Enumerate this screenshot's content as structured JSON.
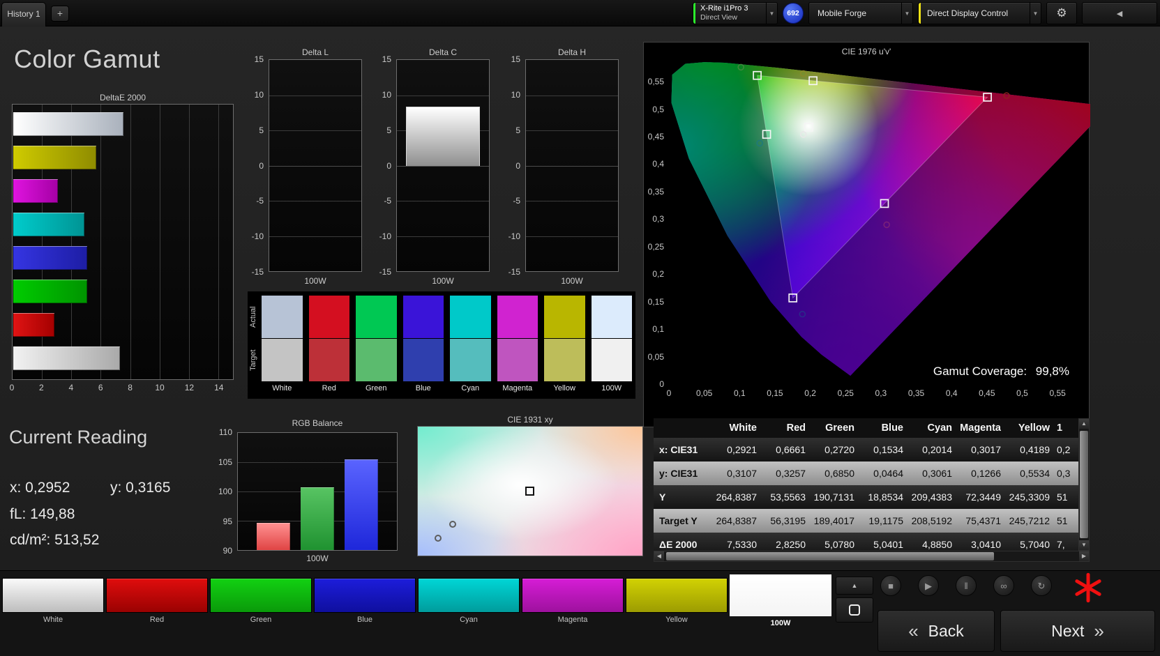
{
  "page_title": "Color Gamut",
  "top_bar": {
    "history_tab": "History 1",
    "add_tab_label": "+",
    "meter_line1": "X-Rite i1Pro 3",
    "meter_line2": "Direct View",
    "badge_count": "692",
    "pattern_source": "Mobile Forge",
    "display_control": "Direct Display Control"
  },
  "icons": {
    "dropdown": "▼",
    "gear": "⚙",
    "collapse_left": "◀",
    "up_chevron": "▲",
    "stop": "■",
    "play": "▶",
    "pause": "‖",
    "loop": "∞",
    "refresh": "↻",
    "scroll_up": "▲",
    "scroll_down": "▼",
    "scroll_left": "◀",
    "scroll_right": "▶",
    "back_chevron": "«",
    "next_chevron": "»"
  },
  "current_reading": {
    "title": "Current Reading",
    "x": "x: 0,2952",
    "y": "y: 0,3165",
    "fl": "fL: 149,88",
    "luminance": "cd/m²: 513,52"
  },
  "swatch_panel": {
    "row_labels": [
      "Actual",
      "Target"
    ],
    "columns": [
      {
        "name": "White",
        "actual": "#b7c3d6",
        "target": "#c4c4c4"
      },
      {
        "name": "Red",
        "actual": "#d40f20",
        "target": "#bd3038"
      },
      {
        "name": "Green",
        "actual": "#00c853",
        "target": "#5bbb6e"
      },
      {
        "name": "Blue",
        "actual": "#3a14d8",
        "target": "#2f3fae"
      },
      {
        "name": "Cyan",
        "actual": "#00c9c9",
        "target": "#55bdbd"
      },
      {
        "name": "Magenta",
        "actual": "#d023d0",
        "target": "#bf55bf"
      },
      {
        "name": "Yellow",
        "actual": "#b9b600",
        "target": "#bdbd5a"
      },
      {
        "name": "100W",
        "actual": "#dcebfc",
        "target": "#f0f0f0"
      }
    ]
  },
  "table": {
    "headers": [
      "White",
      "Red",
      "Green",
      "Blue",
      "Cyan",
      "Magenta",
      "Yellow",
      "1"
    ],
    "rows": [
      {
        "label": "x: CIE31",
        "values": [
          "0,2921",
          "0,6661",
          "0,2720",
          "0,1534",
          "0,2014",
          "0,3017",
          "0,4189",
          "0,2"
        ]
      },
      {
        "label": "y: CIE31",
        "values": [
          "0,3107",
          "0,3257",
          "0,6850",
          "0,0464",
          "0,3061",
          "0,1266",
          "0,5534",
          "0,3"
        ]
      },
      {
        "label": "Y",
        "values": [
          "264,8387",
          "53,5563",
          "190,7131",
          "18,8534",
          "209,4383",
          "72,3449",
          "245,3309",
          "51"
        ]
      },
      {
        "label": "Target Y",
        "values": [
          "264,8387",
          "56,3195",
          "189,4017",
          "19,1175",
          "208,5192",
          "75,4371",
          "245,7212",
          "51"
        ]
      },
      {
        "label": "ΔE 2000",
        "values": [
          "7,5330",
          "2,8250",
          "5,0780",
          "5,0401",
          "4,8850",
          "3,0410",
          "5,7040",
          "7,"
        ]
      }
    ]
  },
  "bottom_strip": {
    "swatches": [
      {
        "name": "White",
        "from": "#fafafa",
        "to": "#bdbdbd",
        "selected": false
      },
      {
        "name": "Red",
        "from": "#e00d0d",
        "to": "#9a0202",
        "selected": false
      },
      {
        "name": "Green",
        "from": "#12d112",
        "to": "#0a9a0a",
        "selected": false
      },
      {
        "name": "Blue",
        "from": "#1d1ddb",
        "to": "#0f0f9e",
        "selected": false
      },
      {
        "name": "Cyan",
        "from": "#00d6d6",
        "to": "#009c9c",
        "selected": false
      },
      {
        "name": "Magenta",
        "from": "#d61dd6",
        "to": "#9e119e",
        "selected": false
      },
      {
        "name": "Yellow",
        "from": "#d2d203",
        "to": "#9c9c02",
        "selected": false
      },
      {
        "name": "100W",
        "from": "#ffffff",
        "to": "#f4f4f4",
        "selected": true
      }
    ]
  },
  "nav": {
    "back_label": "Back",
    "next_label": "Next"
  },
  "chart_data": [
    {
      "id": "deltae2000",
      "type": "bar",
      "orientation": "horizontal",
      "title": "DeltaE 2000",
      "x_ticks": [
        "0",
        "2",
        "4",
        "6",
        "8",
        "10",
        "12",
        "14"
      ],
      "xlim": [
        0,
        15
      ],
      "categories": [
        "White",
        "Yellow",
        "Magenta",
        "Cyan",
        "Blue",
        "Green",
        "Red",
        "100W"
      ],
      "values": [
        7.53,
        5.7,
        3.04,
        4.89,
        5.04,
        5.08,
        2.83,
        7.3
      ],
      "bar_colors": [
        [
          "#ffffff",
          "#a9b1bc"
        ],
        [
          "#cfcb00",
          "#8f8c00"
        ],
        [
          "#e014e0",
          "#a400a4"
        ],
        [
          "#00cccc",
          "#009494"
        ],
        [
          "#3535e2",
          "#1d1da4"
        ],
        [
          "#00cc00",
          "#009400"
        ],
        [
          "#e01414",
          "#a40000"
        ],
        [
          "#f2f2f2",
          "#a9a9a9"
        ]
      ]
    },
    {
      "id": "delta_l",
      "type": "bar",
      "title": "Delta L",
      "y_ticks": [
        "15",
        "10",
        "5",
        "0",
        "-5",
        "-10",
        "-15"
      ],
      "ylim": [
        -15,
        15
      ],
      "categories": [
        "100W"
      ],
      "values": [
        0
      ]
    },
    {
      "id": "delta_c",
      "type": "bar",
      "title": "Delta C",
      "y_ticks": [
        "15",
        "10",
        "5",
        "0",
        "-5",
        "-10",
        "-15"
      ],
      "ylim": [
        -15,
        15
      ],
      "categories": [
        "100W"
      ],
      "values": [
        8.4
      ]
    },
    {
      "id": "delta_h",
      "type": "bar",
      "title": "Delta H",
      "y_ticks": [
        "15",
        "10",
        "5",
        "0",
        "-5",
        "-10",
        "-15"
      ],
      "ylim": [
        -15,
        15
      ],
      "categories": [
        "100W"
      ],
      "values": [
        0
      ]
    },
    {
      "id": "cie1976",
      "type": "scatter",
      "title": "CIE 1976 u'v'",
      "x_ticks": [
        "0",
        "0,05",
        "0,1",
        "0,15",
        "0,2",
        "0,25",
        "0,3",
        "0,35",
        "0,4",
        "0,45",
        "0,5",
        "0,55"
      ],
      "y_ticks": [
        "0,55",
        "0,5",
        "0,45",
        "0,4",
        "0,35",
        "0,3",
        "0,25",
        "0,2",
        "0,15",
        "0,1",
        "0,05",
        "0"
      ],
      "xlim": [
        0,
        0.596
      ],
      "ylim": [
        0,
        0.622
      ],
      "gamut_triangle": {
        "red": [
          0.4507,
          0.5229
        ],
        "green": [
          0.125,
          0.5625
        ],
        "blue": [
          0.1754,
          0.1579
        ]
      },
      "targets": [
        {
          "name": "green",
          "u": 0.125,
          "v": 0.5625
        },
        {
          "name": "yellow",
          "u": 0.2039,
          "v": 0.5528
        },
        {
          "name": "red",
          "u": 0.4507,
          "v": 0.5229
        },
        {
          "name": "white",
          "u": 0.1978,
          "v": 0.4683
        },
        {
          "name": "cyan",
          "u": 0.1383,
          "v": 0.4554
        },
        {
          "name": "magenta",
          "u": 0.305,
          "v": 0.3297
        },
        {
          "name": "blue",
          "u": 0.1754,
          "v": 0.1579
        }
      ],
      "measured": [
        {
          "name": "green",
          "u": 0.1019,
          "v": 0.5774,
          "ring": "#3c8a3c"
        },
        {
          "name": "yellow",
          "u": 0.1903,
          "v": 0.5658,
          "ring": "#8a8a2a"
        },
        {
          "name": "red",
          "u": 0.4778,
          "v": 0.5257,
          "ring": "#8a2020"
        },
        {
          "name": "white",
          "u": 0.1902,
          "v": 0.4551,
          "ring": "#e8e8e8"
        },
        {
          "name": "cyan",
          "u": 0.1285,
          "v": 0.4393,
          "ring": "#1f7a7a"
        },
        {
          "name": "magenta",
          "u": 0.3082,
          "v": 0.291,
          "ring": "#7a207a"
        },
        {
          "name": "blue",
          "u": 0.1888,
          "v": 0.1285,
          "ring": "#2a2a8a"
        }
      ],
      "coverage_label": "Gamut Coverage:",
      "coverage_value": "99,8%"
    },
    {
      "id": "rgb_balance",
      "type": "bar",
      "title": "RGB Balance",
      "y_ticks": [
        "110",
        "105",
        "100",
        "95",
        "90"
      ],
      "ylim": [
        90,
        110
      ],
      "categories": [
        "Red",
        "Green",
        "Blue"
      ],
      "values": [
        94.7,
        100.7,
        105.5
      ],
      "bar_colors": [
        [
          "#ff9292",
          "#e04444"
        ],
        [
          "#58c463",
          "#1f9230"
        ],
        [
          "#5a64ff",
          "#1e27da"
        ]
      ],
      "x_label": "100W"
    },
    {
      "id": "cie1931",
      "type": "scatter",
      "title": "CIE 1931 xy",
      "target_square": {
        "x": 0.5,
        "y": 0.5
      },
      "measured_circles": [
        {
          "x": 0.155,
          "y": 0.755
        },
        {
          "x": 0.09,
          "y": 0.865
        }
      ]
    }
  ]
}
